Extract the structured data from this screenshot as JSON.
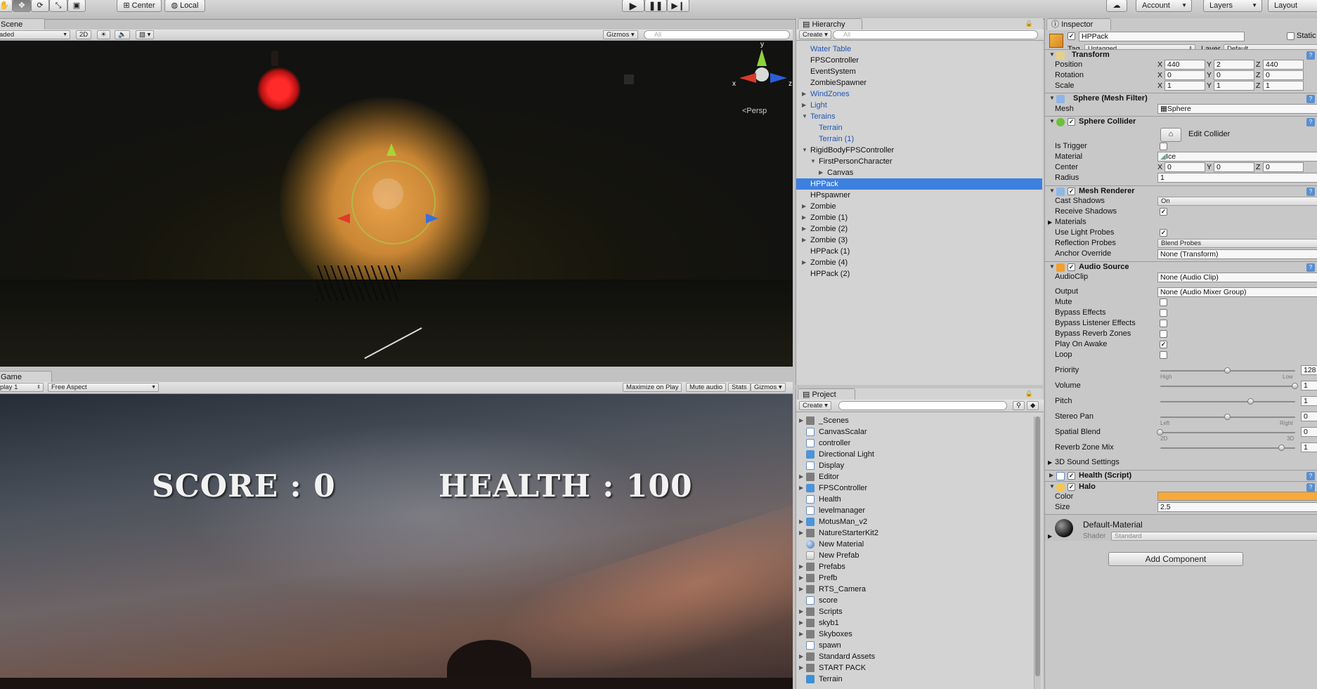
{
  "toolbar": {
    "pivot_label": "Center",
    "space_label": "Local",
    "collab_icon": "cloud-icon",
    "account_label": "Account",
    "layers_label": "Layers",
    "layout_label": "Layout"
  },
  "scene": {
    "tab": "Scene",
    "shading_mode": "aded",
    "mode_2d": "2D",
    "gizmos": "Gizmos",
    "search_placeholder": "All",
    "persp_label": "<Persp",
    "axis_labels": {
      "y": "y",
      "x": "x",
      "z": "z"
    }
  },
  "game": {
    "tab": "Game",
    "display": "play 1",
    "aspect": "Free Aspect",
    "maximize": "Maximize on Play",
    "mute": "Mute audio",
    "stats": "Stats",
    "gizmos": "Gizmos",
    "score": "SCORE : 0",
    "health": "HEALTH : 100"
  },
  "hierarchy": {
    "tab": "Hierarchy",
    "create": "Create",
    "search_placeholder": "All",
    "items": [
      {
        "label": "Water Table",
        "indent": 0,
        "arrow": "",
        "prefab": true
      },
      {
        "label": "FPSController",
        "indent": 0,
        "arrow": "",
        "prefab": false
      },
      {
        "label": "EventSystem",
        "indent": 0,
        "arrow": "",
        "prefab": false
      },
      {
        "label": "ZombieSpawner",
        "indent": 0,
        "arrow": "",
        "prefab": false
      },
      {
        "label": "WindZones",
        "indent": 0,
        "arrow": "▶",
        "prefab": true
      },
      {
        "label": "Light",
        "indent": 0,
        "arrow": "▶",
        "prefab": true
      },
      {
        "label": "Terains",
        "indent": 0,
        "arrow": "▼",
        "prefab": true
      },
      {
        "label": "Terrain",
        "indent": 1,
        "arrow": "",
        "prefab": true
      },
      {
        "label": "Terrain (1)",
        "indent": 1,
        "arrow": "",
        "prefab": true
      },
      {
        "label": "RigidBodyFPSController",
        "indent": 0,
        "arrow": "▼",
        "prefab": false
      },
      {
        "label": "FirstPersonCharacter",
        "indent": 1,
        "arrow": "▼",
        "prefab": false
      },
      {
        "label": "Canvas",
        "indent": 2,
        "arrow": "▶",
        "prefab": false
      },
      {
        "label": "HPPack",
        "indent": 0,
        "arrow": "",
        "prefab": false,
        "selected": true
      },
      {
        "label": "HPspawner",
        "indent": 0,
        "arrow": "",
        "prefab": false
      },
      {
        "label": "Zombie",
        "indent": 0,
        "arrow": "▶",
        "prefab": false
      },
      {
        "label": "Zombie (1)",
        "indent": 0,
        "arrow": "▶",
        "prefab": false
      },
      {
        "label": "Zombie (2)",
        "indent": 0,
        "arrow": "▶",
        "prefab": false
      },
      {
        "label": "Zombie (3)",
        "indent": 0,
        "arrow": "▶",
        "prefab": false
      },
      {
        "label": "HPPack (1)",
        "indent": 0,
        "arrow": "",
        "prefab": false
      },
      {
        "label": "Zombie (4)",
        "indent": 0,
        "arrow": "▶",
        "prefab": false
      },
      {
        "label": "HPPack (2)",
        "indent": 0,
        "arrow": "",
        "prefab": false
      }
    ]
  },
  "project": {
    "tab": "Project",
    "create": "Create",
    "items": [
      {
        "label": "_Scenes",
        "icon": "folder",
        "arrow": "▶"
      },
      {
        "label": "CanvasScalar",
        "icon": "script",
        "arrow": ""
      },
      {
        "label": "controller",
        "icon": "script",
        "arrow": ""
      },
      {
        "label": "Directional Light",
        "icon": "prefab",
        "arrow": ""
      },
      {
        "label": "Display",
        "icon": "script",
        "arrow": ""
      },
      {
        "label": "Editor",
        "icon": "folder",
        "arrow": "▶"
      },
      {
        "label": "FPSController",
        "icon": "prefab",
        "arrow": "▶"
      },
      {
        "label": "Health",
        "icon": "script",
        "arrow": ""
      },
      {
        "label": "levelmanager",
        "icon": "script",
        "arrow": ""
      },
      {
        "label": "MotusMan_v2",
        "icon": "prefab",
        "arrow": "▶"
      },
      {
        "label": "NatureStarterKit2",
        "icon": "folder",
        "arrow": "▶"
      },
      {
        "label": "New Material",
        "icon": "mat",
        "arrow": ""
      },
      {
        "label": "New Prefab",
        "icon": "gray",
        "arrow": ""
      },
      {
        "label": "Prefabs",
        "icon": "folder",
        "arrow": "▶"
      },
      {
        "label": "Prefb",
        "icon": "folder",
        "arrow": "▶"
      },
      {
        "label": "RTS_Camera",
        "icon": "folder",
        "arrow": "▶"
      },
      {
        "label": "score",
        "icon": "script",
        "arrow": ""
      },
      {
        "label": "Scripts",
        "icon": "folder",
        "arrow": "▶"
      },
      {
        "label": "skyb1",
        "icon": "folder",
        "arrow": "▶"
      },
      {
        "label": "Skyboxes",
        "icon": "folder",
        "arrow": "▶"
      },
      {
        "label": "spawn",
        "icon": "script",
        "arrow": ""
      },
      {
        "label": "Standard Assets",
        "icon": "folder",
        "arrow": "▶"
      },
      {
        "label": "START PACK",
        "icon": "folder",
        "arrow": "▶"
      },
      {
        "label": "Terrain",
        "icon": "terr",
        "arrow": ""
      }
    ]
  },
  "inspector": {
    "tab": "Inspector",
    "name": "HPPack",
    "static_label": "Static",
    "tag_label": "Tag",
    "tag_value": "Untagged",
    "layer_label": "Layer",
    "layer_value": "Default",
    "transform": {
      "title": "Transform",
      "position_label": "Position",
      "position": [
        "440",
        "2",
        "440"
      ],
      "rotation_label": "Rotation",
      "rotation": [
        "0",
        "0",
        "0"
      ],
      "scale_label": "Scale",
      "scale": [
        "1",
        "1",
        "1"
      ],
      "axes": [
        "X",
        "Y",
        "Z"
      ]
    },
    "mesh_filter": {
      "title": "Sphere (Mesh Filter)",
      "mesh_label": "Mesh",
      "mesh_value": "Sphere"
    },
    "sphere_collider": {
      "title": "Sphere Collider",
      "edit_label": "Edit Collider",
      "is_trigger_label": "Is Trigger",
      "material_label": "Material",
      "material_value": "Ice",
      "center_label": "Center",
      "center": [
        "0",
        "0",
        "0"
      ],
      "radius_label": "Radius",
      "radius": "1"
    },
    "mesh_renderer": {
      "title": "Mesh Renderer",
      "cast_shadows_label": "Cast Shadows",
      "cast_shadows": "On",
      "receive_shadows_label": "Receive Shadows",
      "materials_label": "Materials",
      "light_probes_label": "Use Light Probes",
      "reflection_probes_label": "Reflection Probes",
      "reflection_probes": "Blend Probes",
      "anchor_label": "Anchor Override",
      "anchor": "None (Transform)"
    },
    "audio_source": {
      "title": "Audio Source",
      "clip_label": "AudioClip",
      "clip": "None (Audio Clip)",
      "output_label": "Output",
      "output": "None (Audio Mixer Group)",
      "mute_label": "Mute",
      "bypass_effects_label": "Bypass Effects",
      "bypass_listener_label": "Bypass Listener Effects",
      "bypass_reverb_label": "Bypass Reverb Zones",
      "play_on_awake_label": "Play On Awake",
      "loop_label": "Loop",
      "priority_label": "Priority",
      "priority": "128",
      "priority_level": 0.5,
      "high_label": "High",
      "low_label": "Low",
      "volume_label": "Volume",
      "volume": "1",
      "volume_level": 1.0,
      "pitch_label": "Pitch",
      "pitch": "1",
      "pitch_level": 0.67,
      "stereo_pan_label": "Stereo Pan",
      "stereo_pan": "0",
      "stereo_pan_level": 0.5,
      "left_label": "Left",
      "right_label": "Right",
      "spatial_label": "Spatial Blend",
      "spatial": "0",
      "spatial_level": 0.0,
      "label_2d": "2D",
      "label_3d": "3D",
      "reverb_mix_label": "Reverb Zone Mix",
      "reverb_mix": "1",
      "reverb_mix_level": 0.9,
      "sound_settings_label": "3D Sound Settings"
    },
    "health_script": {
      "title": "Health (Script)"
    },
    "halo": {
      "title": "Halo",
      "color_label": "Color",
      "color_value": "#f7a93b",
      "size_label": "Size",
      "size": "2.5"
    },
    "material": {
      "name": "Default-Material",
      "shader_label": "Shader",
      "shader": "Standard"
    },
    "add_component": "Add Component"
  },
  "colors": {
    "selection": "#3d80df",
    "prefab_text": "#1f55b8",
    "halo": "#f7a93b"
  }
}
